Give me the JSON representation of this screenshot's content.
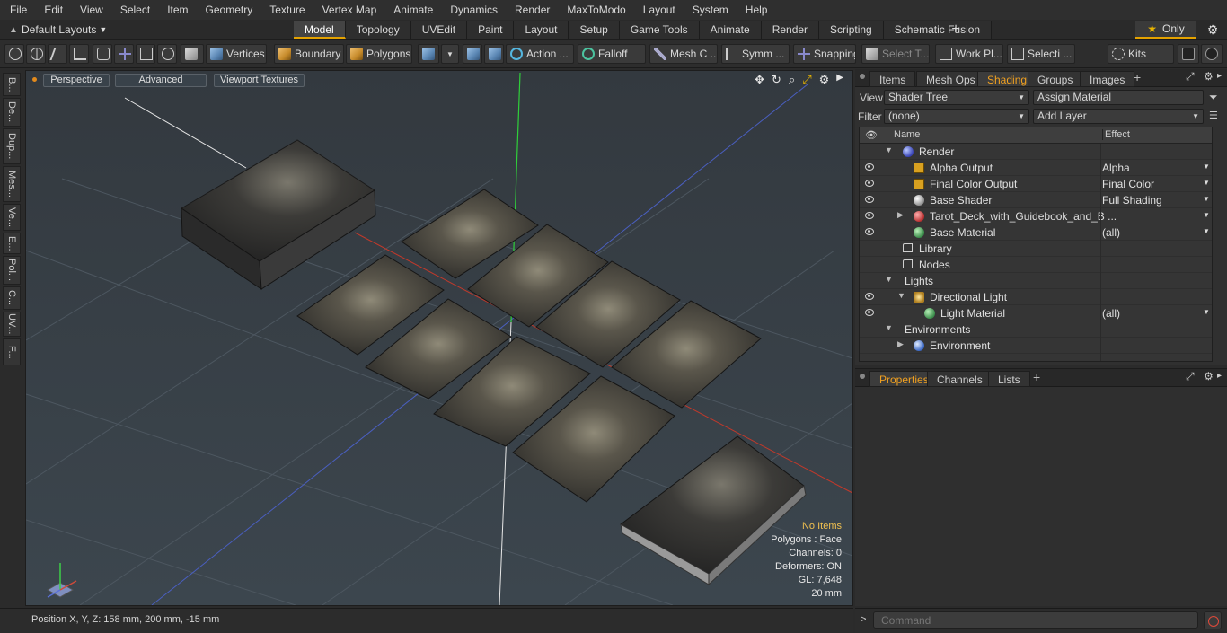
{
  "menu": [
    "File",
    "Edit",
    "View",
    "Select",
    "Item",
    "Geometry",
    "Texture",
    "Vertex Map",
    "Animate",
    "Dynamics",
    "Render",
    "MaxToModo",
    "Layout",
    "System",
    "Help"
  ],
  "layouts_label": "Default Layouts",
  "layout_tabs": [
    "Model",
    "Topology",
    "UVEdit",
    "Paint",
    "Layout",
    "Setup",
    "Game Tools",
    "Animate",
    "Render",
    "Scripting",
    "Schematic Fusion"
  ],
  "active_layout_tab": "Model",
  "only_label": "Only",
  "toolbar": {
    "vertices": "Vertices",
    "boundary": "Boundary",
    "polygons": "Polygons",
    "action": "Action ...",
    "falloff": "Falloff",
    "mesh": "Mesh C ...",
    "symm": "Symm ...",
    "snapping": "Snapping",
    "select_t": "Select T...",
    "work_pl": "Work Pl...",
    "selecti": "Selecti ...",
    "kits": "Kits"
  },
  "left_strip": [
    "B...",
    "De...",
    "Dup...",
    "Mes...",
    "Ve...",
    "E...",
    "Pol...",
    "C...",
    "UV...",
    "F..."
  ],
  "viewport": {
    "perspective": "Perspective",
    "advanced": "Advanced",
    "viewport_textures": "Viewport Textures",
    "info": {
      "no_items": "No Items",
      "polygons": "Polygons : Face",
      "channels": "Channels: 0",
      "deformers": "Deformers: ON",
      "gl": "GL: 7,648",
      "scale": "20 mm"
    }
  },
  "shading_panel": {
    "tabs": [
      "Items",
      "Mesh Ops",
      "Shading",
      "Groups",
      "Images"
    ],
    "active_tab": "Shading",
    "view_label": "View",
    "view_value": "Shader Tree",
    "assign_material": "Assign Material",
    "filter_label": "Filter",
    "filter_value": "(none)",
    "add_layer": "Add Layer",
    "columns": {
      "name": "Name",
      "effect": "Effect"
    },
    "rows": [
      {
        "name": "Render",
        "effect": ""
      },
      {
        "name": "Alpha Output",
        "effect": "Alpha"
      },
      {
        "name": "Final Color Output",
        "effect": "Final Color"
      },
      {
        "name": "Base Shader",
        "effect": "Full Shading"
      },
      {
        "name": "Tarot_Deck_with_Guidebook_and_B ...",
        "effect": ""
      },
      {
        "name": "Base Material",
        "effect": "(all)"
      },
      {
        "name": "Library",
        "effect": ""
      },
      {
        "name": "Nodes",
        "effect": ""
      },
      {
        "name": "Lights",
        "effect": ""
      },
      {
        "name": "Directional Light",
        "effect": ""
      },
      {
        "name": "Light Material",
        "effect": "(all)"
      },
      {
        "name": "Environments",
        "effect": ""
      },
      {
        "name": "Environment",
        "effect": ""
      }
    ]
  },
  "properties_panel": {
    "tabs": [
      "Properties",
      "Channels",
      "Lists"
    ],
    "active_tab": "Properties"
  },
  "status": {
    "position": "Position X, Y, Z:   158 mm, 200 mm, -15 mm",
    "command_placeholder": "Command"
  }
}
